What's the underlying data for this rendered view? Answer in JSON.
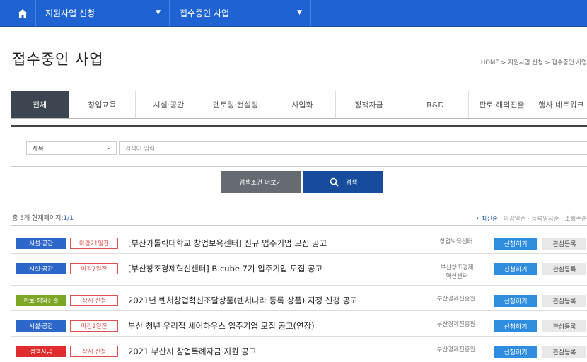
{
  "topnav": {
    "home_icon": "home-icon",
    "menu1": "지원사업 신청",
    "menu2": "접수중인 사업",
    "bg_color": "#1f63d3"
  },
  "page": {
    "title": "접수중인 사업",
    "breadcrumb": "HOME  >  지원사업 신청  >  접수중인 사업"
  },
  "tabs": [
    "전체",
    "창업교육",
    "시설·공간",
    "멘토링·컨설팅",
    "사업화",
    "정책자금",
    "R&D",
    "판로·해외진출",
    "행사·네트워크"
  ],
  "search": {
    "select_value": "제목",
    "placeholder": "검색어 입력",
    "more_label": "검색조건 더보기",
    "search_label": "검색"
  },
  "summary": {
    "prefix": "총 5개 현재페이지:",
    "page": "1/1"
  },
  "sort": {
    "active": "• 최신순",
    "others": "· 마감일순  · 등록일자순  · 조회수순"
  },
  "list": [
    {
      "category": "시설·공간",
      "cat_color": "#2c67c9",
      "deadline": "마감21일전",
      "title": "[부산가톨릭대학교 창업보육센터] 신규 입주기업 모집 공고",
      "org": "창업보육센터",
      "apply": "신청하기",
      "fav": "관심등록"
    },
    {
      "category": "시설·공간",
      "cat_color": "#2c67c9",
      "deadline": "마감7일전",
      "title": "[부산창조경제혁신센터] B.cube 7기 입주기업 모집 공고",
      "org": "부산창조경제혁신센터",
      "apply": "신청하기",
      "fav": "관심등록"
    },
    {
      "category": "판로·해외진출",
      "cat_color": "#7ea625",
      "deadline": "상시 신청",
      "title": "2021년 벤처창업혁신조달상품(벤처나라 등록 상품) 지정 신청 공고",
      "org": "부산경제진흥원",
      "apply": "신청하기",
      "fav": "관심등록"
    },
    {
      "category": "시설·공간",
      "cat_color": "#2c67c9",
      "deadline": "마감2일전",
      "title": "부산 청년 우리집 셰어하우스 입주기업 모집 공고(연장)",
      "org": "부산경제진흥원",
      "apply": "신청하기",
      "fav": "관심등록"
    },
    {
      "category": "정책자금",
      "cat_color": "#e02e2e",
      "deadline": "상시 신청",
      "title": "2021 부산시 창업특례자금 지원 공고",
      "org": "부산경제진흥원",
      "apply": "신청하기",
      "fav": "관심등록"
    }
  ]
}
